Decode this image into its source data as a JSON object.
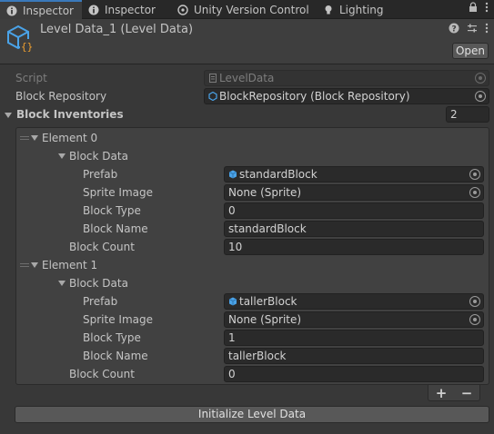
{
  "tabs": [
    {
      "label": "Inspector",
      "icon": "info-icon",
      "active": true
    },
    {
      "label": "Inspector",
      "icon": "info-icon",
      "active": false
    },
    {
      "label": "Unity Version Control",
      "icon": "version-control-icon",
      "active": false
    },
    {
      "label": "Lighting",
      "icon": "lightbulb-icon",
      "active": false
    }
  ],
  "header": {
    "title": "Level Data_1 (Level Data)",
    "open_label": "Open"
  },
  "fields": {
    "script_label": "Script",
    "script_value": "LevelData",
    "repo_label": "Block Repository",
    "repo_value": "BlockRepository (Block Repository)",
    "inventories_label": "Block Inventories",
    "inventories_count": "2"
  },
  "elements": [
    {
      "title": "Element 0",
      "block_data_label": "Block Data",
      "prefab_label": "Prefab",
      "prefab_value": "standardBlock",
      "sprite_label": "Sprite Image",
      "sprite_value": "None (Sprite)",
      "type_label": "Block Type",
      "type_value": "0",
      "name_label": "Block Name",
      "name_value": "standardBlock",
      "count_label": "Block Count",
      "count_value": "10"
    },
    {
      "title": "Element 1",
      "block_data_label": "Block Data",
      "prefab_label": "Prefab",
      "prefab_value": "tallerBlock",
      "sprite_label": "Sprite Image",
      "sprite_value": "None (Sprite)",
      "type_label": "Block Type",
      "type_value": "1",
      "name_label": "Block Name",
      "name_value": "tallerBlock",
      "count_label": "Block Count",
      "count_value": "0"
    }
  ],
  "list_controls": {
    "add": "+",
    "remove": "−"
  },
  "initialize_label": "Initialize Level Data",
  "colors": {
    "accent": "#3a79bb",
    "background": "#383838",
    "field": "#2a2a2a"
  }
}
